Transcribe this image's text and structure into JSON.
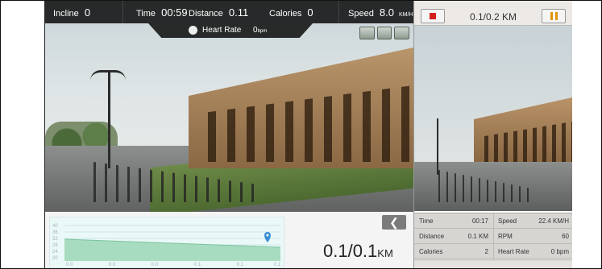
{
  "top_bar": {
    "incline_label": "Incline",
    "incline_value": "0",
    "time_label": "Time",
    "time_value": "00:59",
    "distance_label": "Distance",
    "distance_value": "0.11",
    "calories_label": "Calories",
    "calories_value": "0",
    "speed_label": "Speed",
    "speed_value": "8.0",
    "speed_unit": "KM/H"
  },
  "heart_bar": {
    "label": "Heart Rate",
    "value": "0",
    "unit": "bpm"
  },
  "graph": {
    "y_ticks": [
      "40",
      "36",
      "32",
      "28",
      "24",
      "20"
    ],
    "x_ticks": [
      "0.0",
      "0.0",
      "0.0",
      "0.1",
      "0.1",
      "0.1"
    ]
  },
  "distance_display": {
    "value": "0.1/0.1",
    "unit": "KM"
  },
  "mini": {
    "distance": "0.1/0.2 KM",
    "stats": {
      "time_label": "Time",
      "time_value": "00:17",
      "speed_label": "Speed",
      "speed_value": "22.4 KM/H",
      "distance_label": "Distance",
      "distance_value": "0.1 KM",
      "rpm_label": "RPM",
      "rpm_value": "60",
      "calories_label": "Calories",
      "calories_value": "2",
      "heart_label": "Heart Rate",
      "heart_value": "0 bpm"
    }
  },
  "colors": {
    "graph_bg": "#eaf8f8",
    "graph_fill": "#a8dcc0",
    "marker": "#3a8fd6",
    "stop_red": "#d21f1f",
    "pause_orange": "#e39400"
  }
}
